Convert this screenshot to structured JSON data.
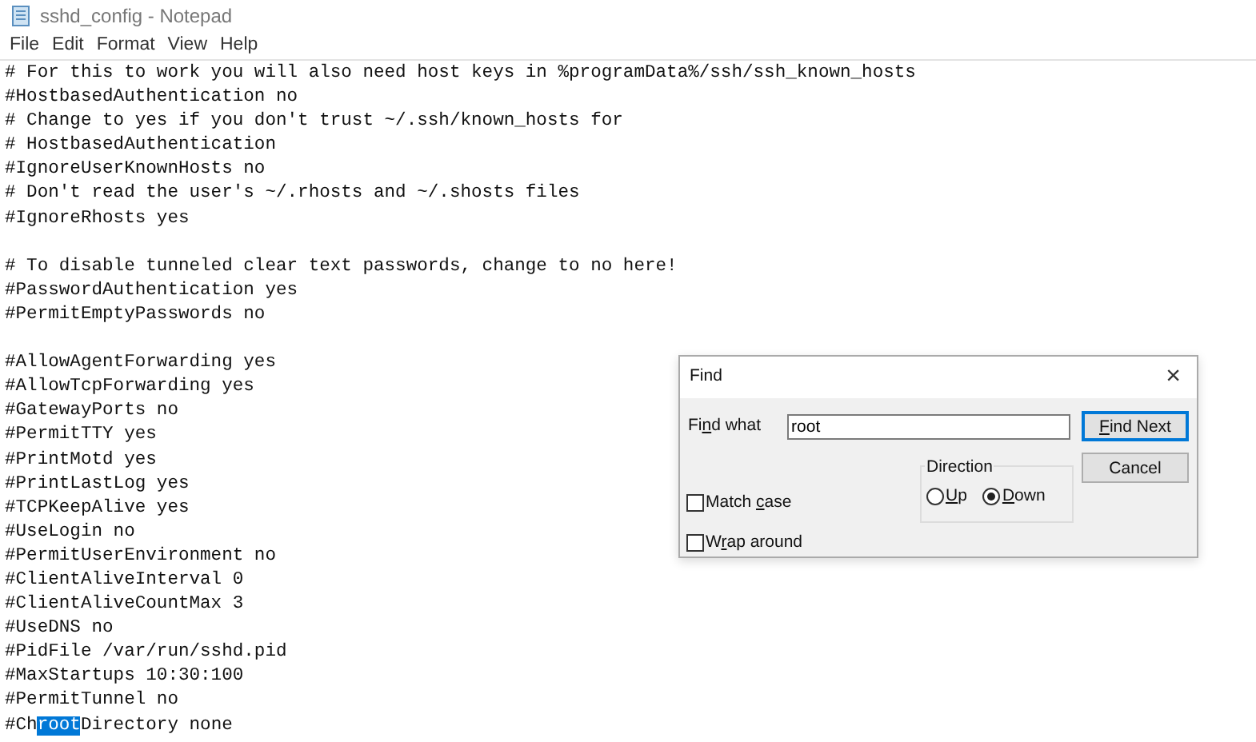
{
  "window": {
    "title": "sshd_config - Notepad"
  },
  "menu": [
    "File",
    "Edit",
    "Format",
    "View",
    "Help"
  ],
  "lines": [
    {
      "text": "# For this to work you will also need host keys in %programData%/ssh/ssh_known_hosts"
    },
    {
      "text": "#HostbasedAuthentication no"
    },
    {
      "text": "# Change to yes if you don't trust ~/.ssh/known_hosts for"
    },
    {
      "text": "# HostbasedAuthentication"
    },
    {
      "text": "#IgnoreUserKnownHosts no"
    },
    {
      "text": "# Don't read the user's ~/.rhosts and ~/.shosts files"
    },
    {
      "text": "#IgnoreRhosts yes"
    },
    {
      "kind": "blank"
    },
    {
      "text": "# To disable tunneled clear text passwords, change to no here!"
    },
    {
      "text": "#PasswordAuthentication yes"
    },
    {
      "text": "#PermitEmptyPasswords no"
    },
    {
      "kind": "blank"
    },
    {
      "text": "#AllowAgentForwarding yes"
    },
    {
      "text": "#AllowTcpForwarding yes"
    },
    {
      "text": "#GatewayPorts no"
    },
    {
      "text": "#PermitTTY yes"
    },
    {
      "text": "#PrintMotd yes"
    },
    {
      "text": "#PrintLastLog yes"
    },
    {
      "text": "#TCPKeepAlive yes"
    },
    {
      "text": "#UseLogin no"
    },
    {
      "text": "#PermitUserEnvironment no"
    },
    {
      "text": "#ClientAliveInterval 0"
    },
    {
      "text": "#ClientAliveCountMax 3"
    },
    {
      "text": "#UseDNS no"
    },
    {
      "text": "#PidFile /var/run/sshd.pid"
    },
    {
      "text": "#MaxStartups 10:30:100"
    },
    {
      "text": "#PermitTunnel no"
    },
    {
      "kind": "selection",
      "before": "#Ch",
      "selected": "root",
      "after": "Directory none"
    }
  ],
  "find_dialog": {
    "title": "Find",
    "close": "×",
    "find_what": {
      "label": {
        "pre": "Fi",
        "key": "n",
        "post": "d what"
      },
      "value": "root"
    },
    "buttons": [
      {
        "label": {
          "key": "F",
          "post": "ind Next"
        },
        "default": true
      },
      {
        "label": {
          "pre": "Cancel"
        },
        "default": false
      }
    ],
    "direction": {
      "label": "Direction",
      "options": [
        {
          "label": {
            "key": "U",
            "post": "p"
          },
          "selected": false
        },
        {
          "label": {
            "key": "D",
            "post": "own"
          },
          "selected": true
        }
      ]
    },
    "checkboxes": [
      {
        "label": {
          "pre": "Match ",
          "key": "c",
          "post": "ase"
        },
        "checked": false
      },
      {
        "label": {
          "pre": "W",
          "key": "r",
          "post": "ap around"
        },
        "checked": false
      }
    ]
  }
}
